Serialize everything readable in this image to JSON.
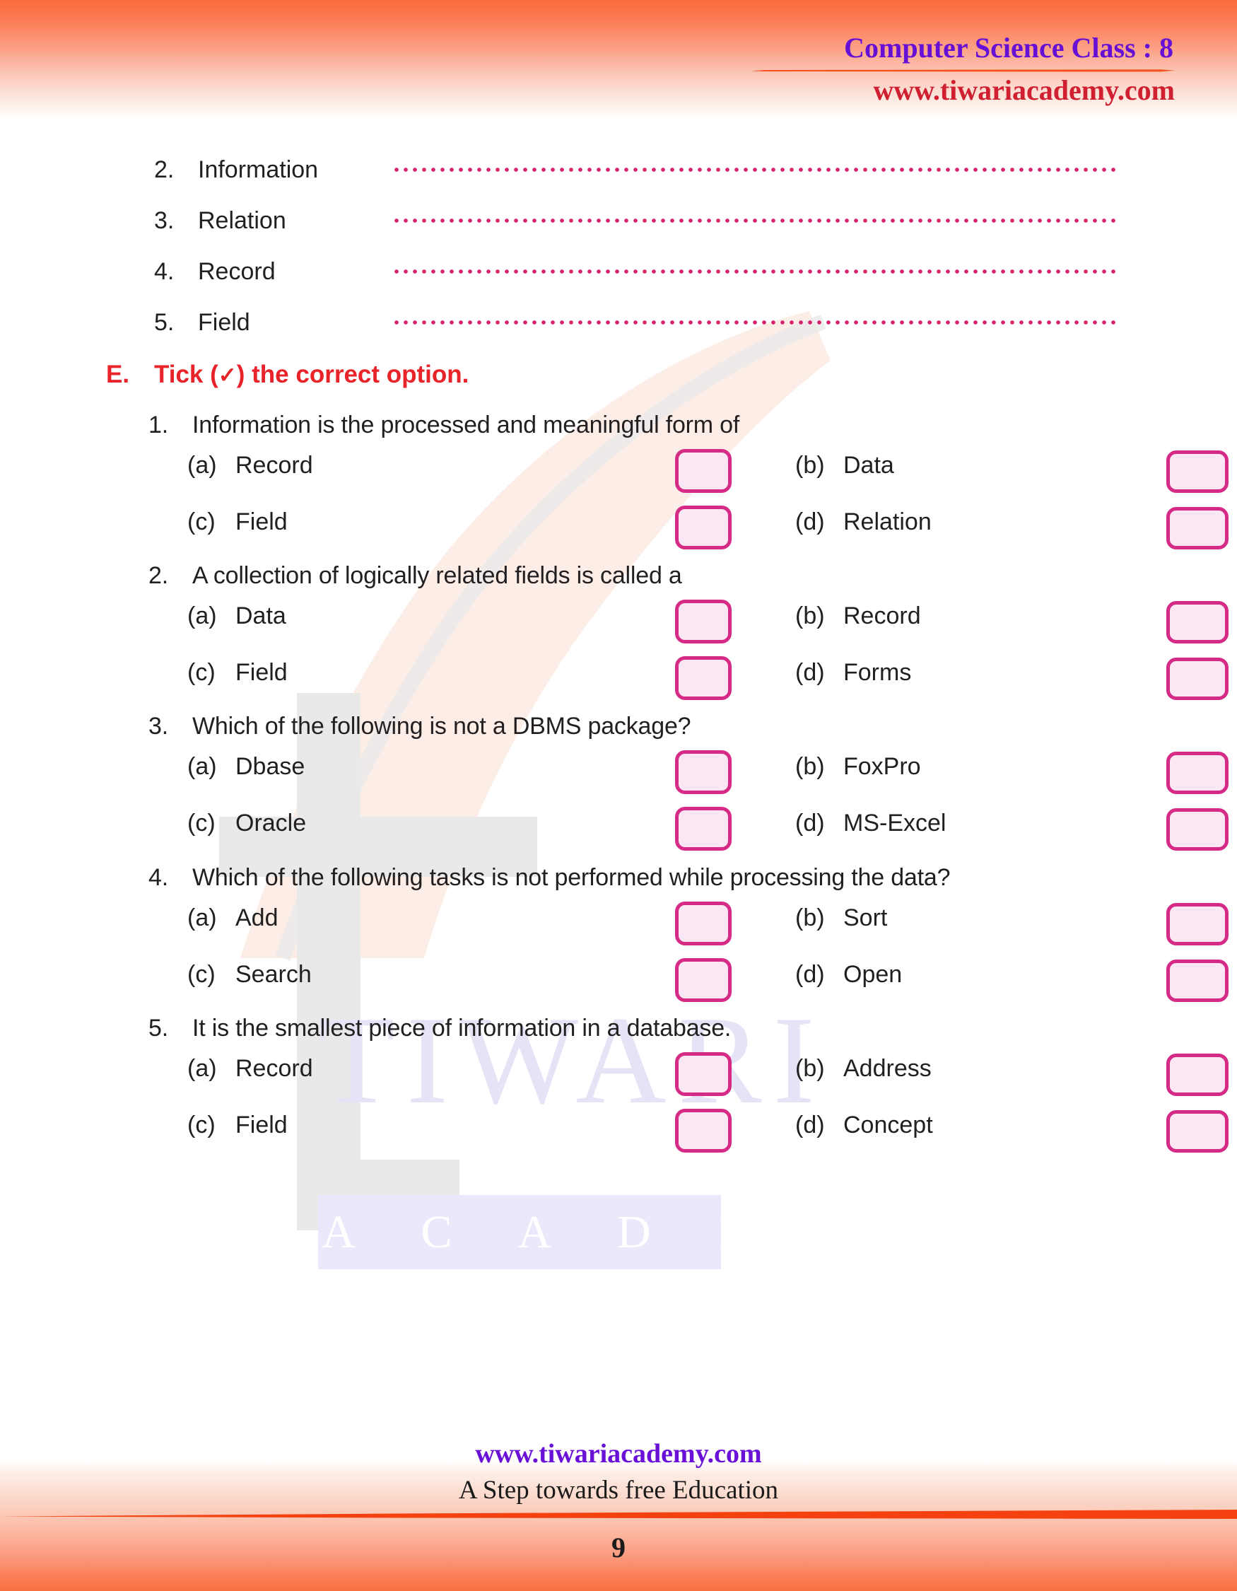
{
  "header": {
    "title": "Computer Science Class : 8",
    "url": "www.tiwariacademy.com"
  },
  "watermark": {
    "word_top": "TIWARI",
    "word_bottom": "A C A D E M Y",
    "letter_mark": "T"
  },
  "fill_in_blanks": [
    {
      "num": "2.",
      "term": "Information"
    },
    {
      "num": "3.",
      "term": "Relation"
    },
    {
      "num": "4.",
      "term": "Record"
    },
    {
      "num": "5.",
      "term": "Field"
    }
  ],
  "section": {
    "letter": "E.",
    "title_before": "Tick (",
    "tick_symbol": "✓",
    "title_after": ") the correct option."
  },
  "questions": [
    {
      "num": "1.",
      "text": "Information is the processed and meaningful form of",
      "options": [
        {
          "tag": "(a)",
          "label": "Record"
        },
        {
          "tag": "(b)",
          "label": "Data"
        },
        {
          "tag": "(c)",
          "label": "Field"
        },
        {
          "tag": "(d)",
          "label": "Relation"
        }
      ]
    },
    {
      "num": "2.",
      "text": "A collection of logically related fields is called a",
      "options": [
        {
          "tag": "(a)",
          "label": "Data"
        },
        {
          "tag": "(b)",
          "label": "Record"
        },
        {
          "tag": "(c)",
          "label": "Field"
        },
        {
          "tag": "(d)",
          "label": "Forms"
        }
      ]
    },
    {
      "num": "3.",
      "text": "Which of the following is not a DBMS package?",
      "options": [
        {
          "tag": "(a)",
          "label": "Dbase"
        },
        {
          "tag": "(b)",
          "label": "FoxPro"
        },
        {
          "tag": "(c)",
          "label": "Oracle"
        },
        {
          "tag": "(d)",
          "label": "MS-Excel"
        }
      ]
    },
    {
      "num": "4.",
      "text": "Which of the following tasks is not performed while processing the data?",
      "options": [
        {
          "tag": "(a)",
          "label": "Add"
        },
        {
          "tag": "(b)",
          "label": "Sort"
        },
        {
          "tag": "(c)",
          "label": "Search"
        },
        {
          "tag": "(d)",
          "label": "Open"
        }
      ]
    },
    {
      "num": "5.",
      "text": "It is the smallest piece of information in a database.",
      "options": [
        {
          "tag": "(a)",
          "label": "Record"
        },
        {
          "tag": "(b)",
          "label": "Address"
        },
        {
          "tag": "(c)",
          "label": "Field"
        },
        {
          "tag": "(d)",
          "label": "Concept"
        }
      ]
    }
  ],
  "footer": {
    "url": "www.tiwariacademy.com",
    "tagline": "A Step towards free Education",
    "page_number": "9"
  },
  "colors": {
    "band_orange": "#fb6a3d",
    "title_purple": "#6610d6",
    "header_url_red": "#cf1f30",
    "section_red": "#e8232a",
    "checkbox_border": "#d52b87",
    "checkbox_fill": "#fbe6f3",
    "dot_line": "#d6216f",
    "footer_url_purple": "#6a11d8",
    "watermark_gray": "#e9e9ea",
    "watermark_lavender": "#e6e3f6"
  }
}
